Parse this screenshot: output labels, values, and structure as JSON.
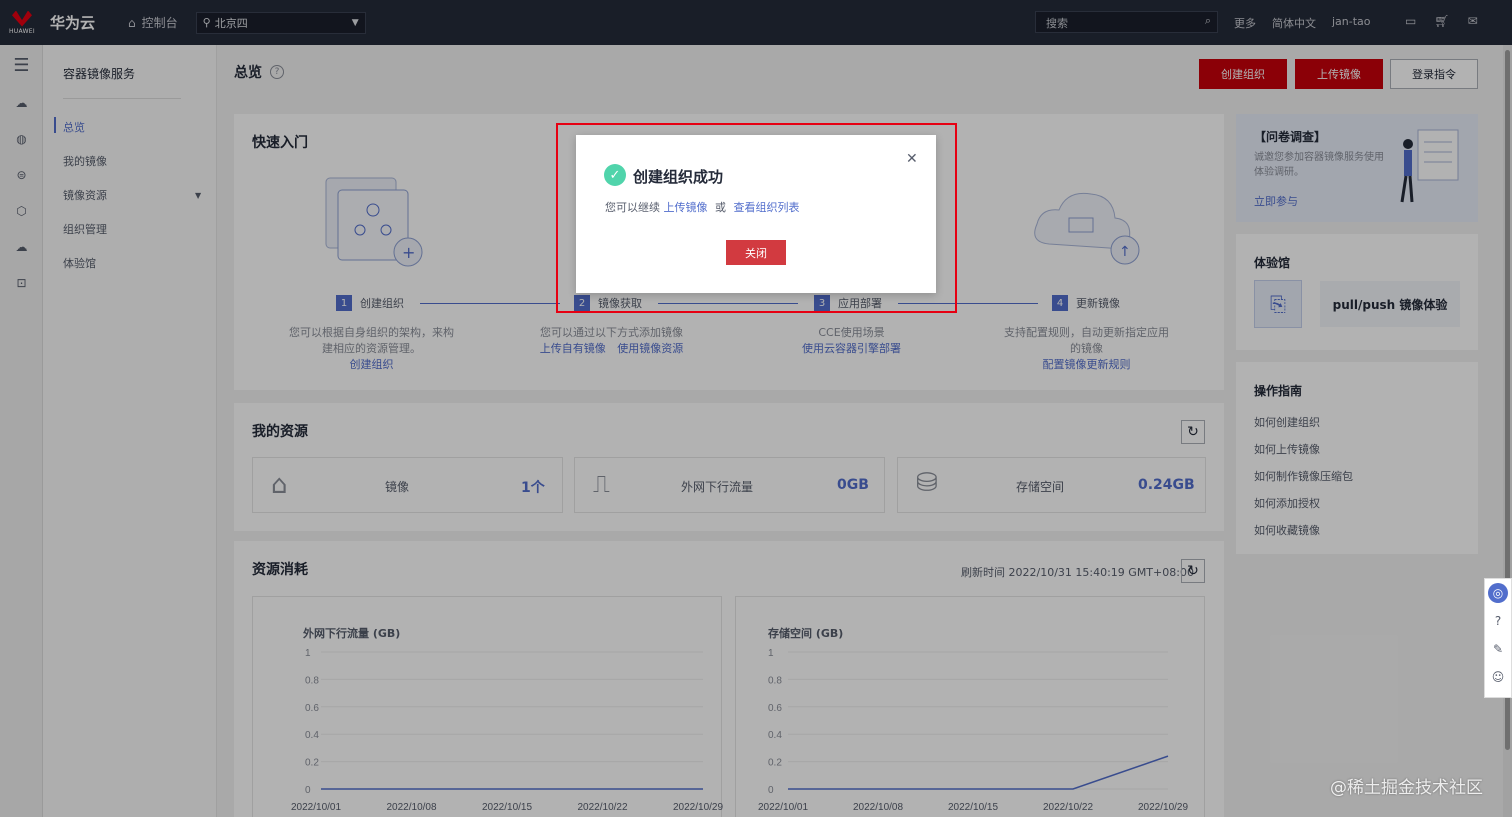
{
  "topbar": {
    "logo_text": "HUAWEI",
    "brand": "华为云",
    "console": "控制台",
    "region": "北京四",
    "search_placeholder": "搜索",
    "more": "更多",
    "lang": "简体中文",
    "user": "jan-tao"
  },
  "sidenav": {
    "service_title": "容器镜像服务",
    "items": [
      "总览",
      "我的镜像",
      "镜像资源",
      "组织管理",
      "体验馆"
    ]
  },
  "page": {
    "title": "总览",
    "buttons": {
      "create_org": "创建组织",
      "upload_image": "上传镜像",
      "login_cmd": "登录指令"
    }
  },
  "quickstart": {
    "title": "快速入门",
    "steps": [
      {
        "no": "1",
        "label": "创建组织",
        "desc1": "您可以根据自身组织的架构，来构",
        "desc2": "建相应的资源管理。",
        "links": [
          "创建组织"
        ]
      },
      {
        "no": "2",
        "label": "镜像获取",
        "desc1": "您可以通过以下方式添加镜像",
        "desc2": "",
        "links": [
          "上传自有镜像",
          "使用镜像资源"
        ]
      },
      {
        "no": "3",
        "label": "应用部署",
        "desc1": "CCE使用场景",
        "desc2": "",
        "links": [
          "使用云容器引擎部署"
        ]
      },
      {
        "no": "4",
        "label": "更新镜像",
        "desc1": "支持配置规则，自动更新指定应用",
        "desc2": "的镜像",
        "links": [
          "配置镜像更新规则"
        ]
      }
    ]
  },
  "resources": {
    "title": "我的资源",
    "items": [
      {
        "label": "镜像",
        "value": "1个"
      },
      {
        "label": "外网下行流量",
        "value": "0GB"
      },
      {
        "label": "存储空间",
        "value": "0.24GB"
      }
    ]
  },
  "consumption": {
    "title": "资源消耗",
    "refresh_time": "刷新时间 2022/10/31 15:40:19 GMT+08:00"
  },
  "chart_data": [
    {
      "type": "line",
      "title": "外网下行流量 (GB)",
      "x": [
        "2022/10/01",
        "2022/10/08",
        "2022/10/15",
        "2022/10/22",
        "2022/10/29"
      ],
      "y_ticks": [
        "1",
        "0.8",
        "0.6",
        "0.4",
        "0.2",
        "0"
      ],
      "ylim": [
        0,
        1
      ],
      "series": [
        {
          "values": [
            0,
            0,
            0,
            0,
            0
          ]
        }
      ],
      "color": "#526ecc"
    },
    {
      "type": "line",
      "title": "存储空间 (GB)",
      "x": [
        "2022/10/01",
        "2022/10/08",
        "2022/10/15",
        "2022/10/22",
        "2022/10/29"
      ],
      "y_ticks": [
        "1",
        "0.8",
        "0.6",
        "0.4",
        "0.2",
        "0"
      ],
      "ylim": [
        0,
        1
      ],
      "series": [
        {
          "values": [
            0,
            0,
            0,
            0,
            0.24
          ]
        }
      ],
      "color": "#526ecc"
    }
  ],
  "right": {
    "survey_title": "【问卷调查】",
    "survey_text1": "诚邀您参加容器镜像服务使用",
    "survey_text2": "体验调研。",
    "survey_link": "立即参与",
    "exp_title": "体验馆",
    "exp_item": "pull/push 镜像体验",
    "guide_title": "操作指南",
    "guides": [
      "如何创建组织",
      "如何上传镜像",
      "如何制作镜像压缩包",
      "如何添加授权",
      "如何收藏镜像"
    ]
  },
  "modal": {
    "title": "创建组织成功",
    "msg_prefix": "您可以继续",
    "link1": "上传镜像",
    "msg_or": "或",
    "link2": "查看组织列表",
    "close_button": "关闭"
  },
  "watermark": "@稀土掘金技术社区"
}
